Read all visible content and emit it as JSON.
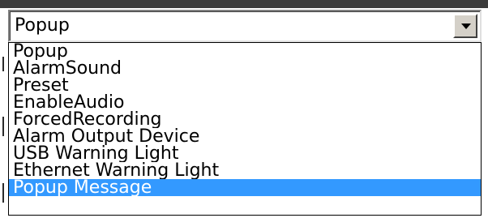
{
  "combo": {
    "selected_value": "Popup",
    "arrow_icon": "chevron-down-icon"
  },
  "dropdown": {
    "options": [
      {
        "label": "Popup",
        "selected": false
      },
      {
        "label": "AlarmSound",
        "selected": false
      },
      {
        "label": "Preset",
        "selected": false
      },
      {
        "label": "EnableAudio",
        "selected": false
      },
      {
        "label": "ForcedRecording",
        "selected": false
      },
      {
        "label": "Alarm Output Device",
        "selected": false
      },
      {
        "label": "USB Warning Light",
        "selected": false
      },
      {
        "label": "Ethernet Warning Light",
        "selected": false
      },
      {
        "label": "Popup Message",
        "selected": true
      }
    ]
  },
  "colors": {
    "highlight": "#3399ff",
    "highlight_text": "#ffffff"
  }
}
